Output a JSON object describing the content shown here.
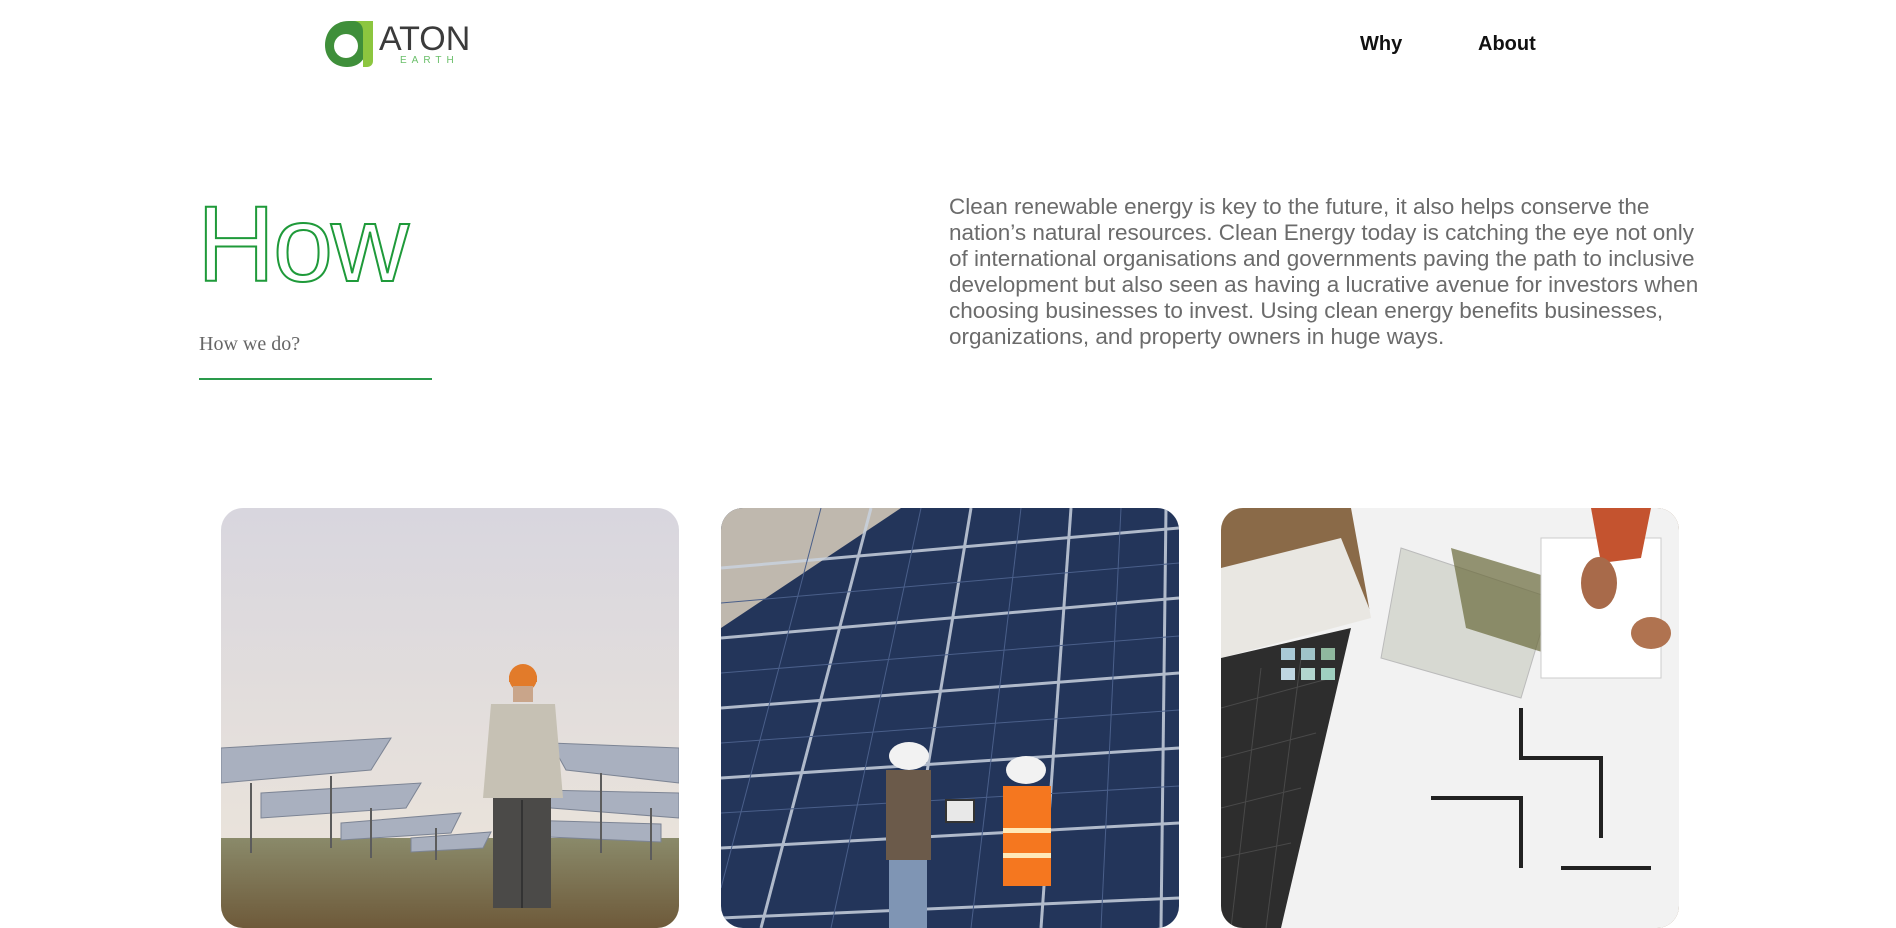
{
  "header": {
    "logo": {
      "word": "ATON",
      "sub": "EARTH",
      "mark": "a-leaf-logo"
    },
    "nav": [
      {
        "label": "Why"
      },
      {
        "label": "About"
      }
    ]
  },
  "hero": {
    "title": "How",
    "subtitle": "How we do?",
    "description": "Clean renewable energy is key to the future, it also helps conserve the nation’s natural resources. Clean Energy today is catching the eye not only of international organisations and governments paving the path to inclusive development but also seen as having a lucrative avenue for investors when choosing businesses to invest. Using clean energy benefits businesses, organizations, and property owners in huge ways."
  },
  "colors": {
    "accent_green": "#1f9a3a",
    "text_gray": "#6b6b6b"
  },
  "cards": [
    {
      "image": "solar-farm-worker-photo"
    },
    {
      "image": "solar-panels-engineers-photo"
    },
    {
      "image": "architectural-blueprints-photo"
    }
  ]
}
